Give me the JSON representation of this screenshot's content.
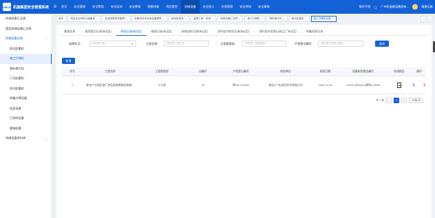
{
  "app": {
    "logo_text": "PMCS",
    "title": "机施集团安全管理系统"
  },
  "nav": [
    {
      "label": "首页"
    },
    {
      "label": "安全管理"
    },
    {
      "label": "安全策划"
    },
    {
      "label": "安全培训"
    },
    {
      "label": "安全教育"
    },
    {
      "label": "隐患排查"
    },
    {
      "label": "风险管控"
    },
    {
      "label": "机械设备",
      "active": true
    },
    {
      "label": "安全投入"
    },
    {
      "label": "应急管理"
    },
    {
      "label": "安全考核"
    },
    {
      "label": "安全事故"
    }
  ],
  "user": {
    "manual": "操作手册",
    "org": "广州机施建设集团有...",
    "name": "隆建运维"
  },
  "sidebar": [
    {
      "label": "机械设备汇总表",
      "type": "item"
    },
    {
      "label": "固定机械设备汇总表",
      "type": "item"
    },
    {
      "label": "机械设备台账",
      "type": "group",
      "arrow": "⌃"
    },
    {
      "label": "塔式起重机",
      "type": "sub"
    },
    {
      "label": "施工升降机",
      "type": "sub",
      "active": true
    },
    {
      "label": "物料提升机",
      "type": "sub"
    },
    {
      "label": "门式起重机",
      "type": "sub"
    },
    {
      "label": "桥式起重机",
      "type": "sub"
    },
    {
      "label": "附着升降设备",
      "type": "sub"
    },
    {
      "label": "挂篮设备",
      "type": "sub"
    },
    {
      "label": "已拆除设备",
      "type": "sub"
    },
    {
      "label": "建筑起重",
      "type": "sub"
    },
    {
      "label": "机械设备资料库",
      "type": "group",
      "arrow": "⌄"
    }
  ],
  "tags": [
    {
      "label": "首页"
    },
    {
      "label": "项目安全风险分级管控"
    },
    {
      "label": "安全隐患排查管理"
    },
    {
      "label": "设备项目安全危险管理表"
    },
    {
      "label": "检测信息表"
    },
    {
      "label": "监理工程一览表"
    },
    {
      "label": "机械设备汇总表"
    },
    {
      "label": "施工升降机"
    },
    {
      "label": "物料提升机"
    },
    {
      "label": "塔式起重机"
    },
    {
      "label": "施工升降机台账",
      "active": true
    }
  ],
  "subtabs": [
    {
      "label": "基本信息"
    },
    {
      "label": "使用登记记录(有)(否)"
    },
    {
      "label": "检验记录(有)(否)",
      "active": true
    },
    {
      "label": "维保记录(有)(否)"
    },
    {
      "label": "安装自检记录(有)(否)"
    },
    {
      "label": "顶升加节检验记录(有)(否)"
    },
    {
      "label": "顶升加节验收记录(工厂有)(否)"
    },
    {
      "label": "附着验收记录"
    }
  ],
  "filters": {
    "date_label": "选择年月:",
    "date_placeholder": "请选择日期",
    "project_label": "工程名称:",
    "project_placeholder": "请选择工程名称",
    "manager_label": "工程管理部:",
    "manager_placeholder": "请选择工程管理部",
    "reg_label": "产权登记编号:",
    "reg_placeholder": "请选择产权登记编号",
    "query_label": "查询"
  },
  "add_label": "新增",
  "table": {
    "headers": [
      "序号",
      "工程名称",
      "工程管理部",
      "自编号",
      "产权登记编号",
      "检验单位",
      "检验日期",
      "设备检验报告编号",
      "检测报告",
      "操作"
    ],
    "rows": [
      {
        "index": "1",
        "project": "珠宝产业园标准厂房及配套基础设施建...",
        "manager": "十七部",
        "self_no": "24",
        "reg_no": "粤MC-S11620",
        "unit": "湖北(广州)检验技术有限公司",
        "date": "2024-12-25",
        "report_no": "CZGZ-Q02024-(博特)-12009",
        "view": "查看",
        "delete": "删除"
      }
    ]
  },
  "pager": {
    "total": "共 1 条",
    "prev": "<",
    "page": "1",
    "next": ">",
    "size": "10条/页"
  }
}
